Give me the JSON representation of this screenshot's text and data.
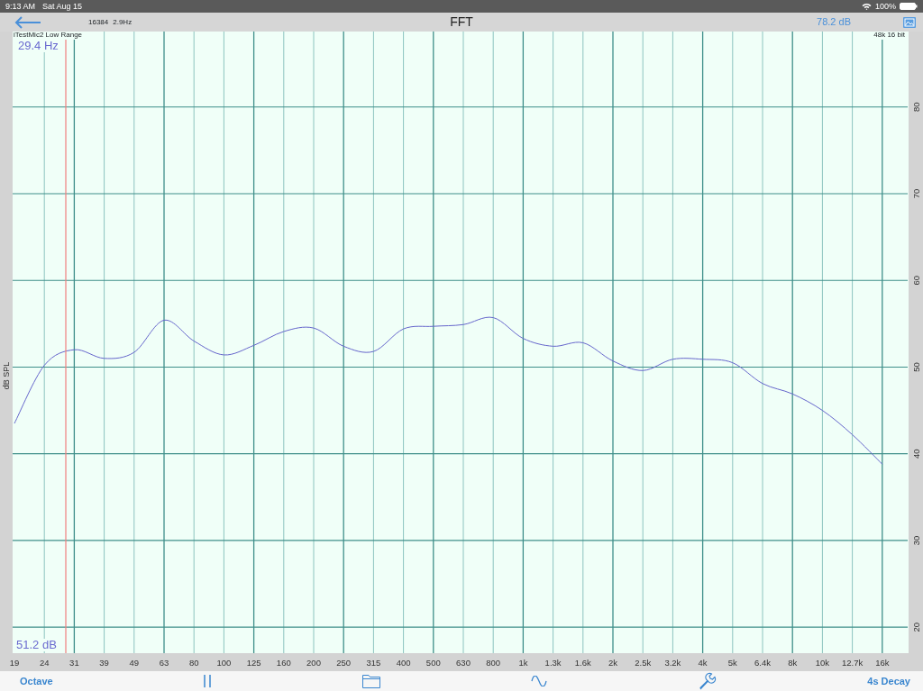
{
  "status_bar": {
    "time": "9:13 AM",
    "date": "Sat Aug 15",
    "battery": "100%"
  },
  "nav_bar": {
    "fft_size": "16384",
    "resolution": "2.9Hz",
    "title": "FFT",
    "level": "78.2 dB"
  },
  "plot": {
    "device": "iTestMic2 Low Range",
    "cursor_frequency": "29.4 Hz",
    "cursor_level": "51.2 dB",
    "format": "48k 16 bit",
    "chart_data": {
      "type": "line",
      "ylabel": "dB SPL",
      "categories": [
        "19",
        "24",
        "31",
        "39",
        "49",
        "63",
        "80",
        "100",
        "125",
        "160",
        "200",
        "250",
        "315",
        "400",
        "500",
        "630",
        "800",
        "1k",
        "1.3k",
        "1.6k",
        "2k",
        "2.5k",
        "3.2k",
        "4k",
        "5k",
        "6.4k",
        "8k",
        "10k",
        "12.7k",
        "16k"
      ],
      "series": [
        {
          "color": "#6666cc",
          "values": [
            43.5,
            50.2,
            52.0,
            51.0,
            51.7,
            55.4,
            53.0,
            51.4,
            52.5,
            54.1,
            54.5,
            52.4,
            51.8,
            54.4,
            54.7,
            54.9,
            55.7,
            53.3,
            52.4,
            52.8,
            50.7,
            49.6,
            50.9,
            50.9,
            50.5,
            48.1,
            46.9,
            45.0,
            42.2,
            38.8
          ]
        }
      ],
      "ylim": [
        17,
        88.7
      ],
      "yticks": [
        20,
        30,
        40,
        50,
        60,
        70,
        80
      ],
      "grid": true
    }
  },
  "toolbar": {
    "left": "Octave",
    "right": "4s Decay"
  }
}
